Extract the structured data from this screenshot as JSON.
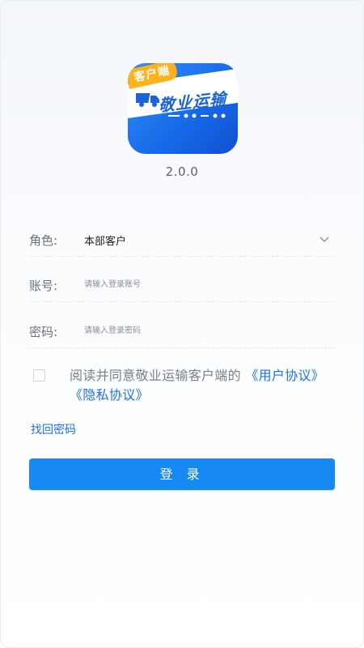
{
  "app_icon": {
    "badge": "客户端",
    "brand": "敬业运输",
    "primary_color": "#1669e8",
    "badge_color": "#ffb21e"
  },
  "version": "2.0.0",
  "form": {
    "role": {
      "label": "角色:",
      "value": "本部客户"
    },
    "account": {
      "label": "账号:",
      "placeholder": "请输入登录账号",
      "value": ""
    },
    "password": {
      "label": "密码:",
      "placeholder": "请输入登录密码",
      "value": ""
    }
  },
  "agreement": {
    "checked": false,
    "text": "阅读并同意敬业运输客户端的",
    "user_link": "《用户协议》",
    "privacy_link": "《隐私协议》"
  },
  "forgot_password": "找回密码",
  "login_button": "登 录",
  "colors": {
    "accent": "#1689f3",
    "link": "#1b72e6"
  }
}
